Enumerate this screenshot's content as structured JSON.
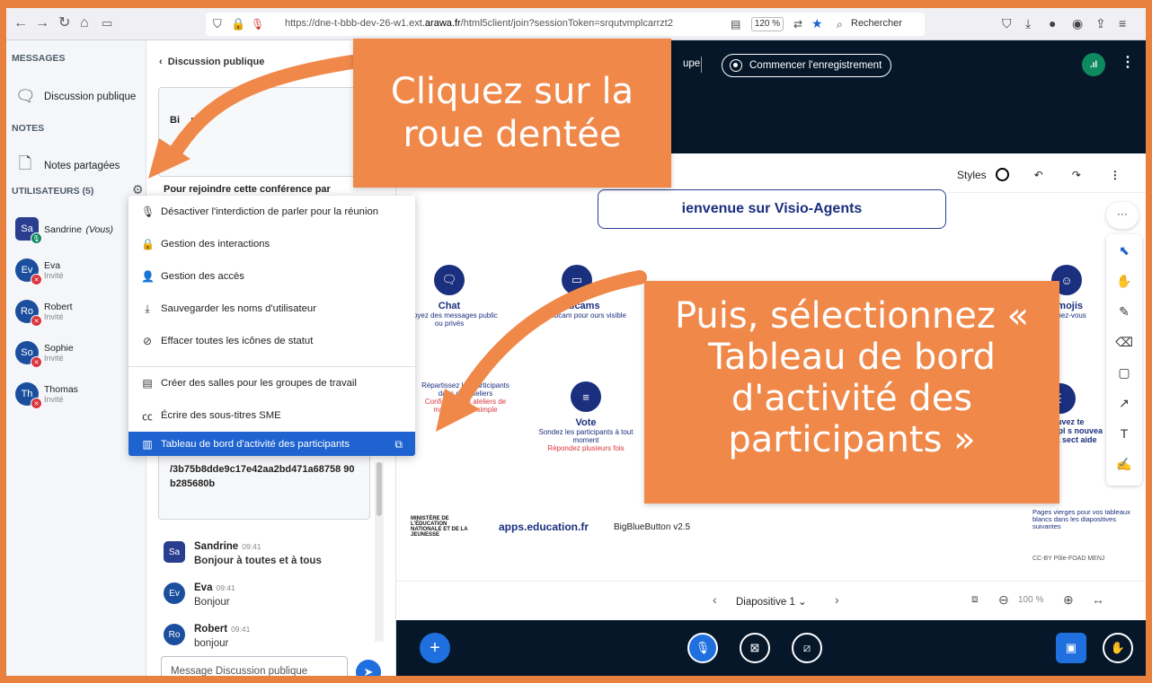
{
  "browser": {
    "url_prefix": "https://dne-t-bbb-dev-26-w1.ext.",
    "url_domain": "arawa.fr",
    "url_suffix": "/html5client/join?sessionToken=srqutvmplcarrzt2",
    "zoom": "120 %",
    "search_placeholder": "Rechercher"
  },
  "sidebar": {
    "messages_title": "MESSAGES",
    "public_chat": "Discussion publique",
    "notes_title": "NOTES",
    "shared_notes": "Notes partagées",
    "users_title": "UTILISATEURS (5)",
    "users": [
      {
        "initials": "Sa",
        "name": "Sandrine",
        "tag": "(Vous)",
        "role": ""
      },
      {
        "initials": "Ev",
        "name": "Eva",
        "tag": "",
        "role": "Invité"
      },
      {
        "initials": "Ro",
        "name": "Robert",
        "tag": "",
        "role": "Invité"
      },
      {
        "initials": "So",
        "name": "Sophie",
        "tag": "",
        "role": "Invité"
      },
      {
        "initials": "Th",
        "name": "Thomas",
        "tag": "",
        "role": "Invité"
      }
    ]
  },
  "chat": {
    "back_label": "Discussion publique",
    "welcome_partial": "Bi    nv",
    "join_text": "Pour rejoindre cette conférence par",
    "session_id": "/3b75b8dde9c17e42aa2bd471a68758 90b285680b",
    "messages": [
      {
        "initials": "Sa",
        "name": "Sandrine",
        "time": "09:41",
        "text": "Bonjour à toutes et à tous"
      },
      {
        "initials": "Ev",
        "name": "Eva",
        "time": "09:41",
        "text": "Bonjour"
      },
      {
        "initials": "Ro",
        "name": "Robert",
        "time": "09:41",
        "text": "bonjour"
      }
    ],
    "input_placeholder": "Message Discussion publique"
  },
  "menu": {
    "items": [
      "Désactiver l'interdiction de parler pour la réunion",
      "Gestion des interactions",
      "Gestion des accès",
      "Sauvegarder les noms d'utilisateur",
      "Effacer toutes les icônes de statut",
      "Créer des salles pour les groupes de travail",
      "Écrire des sous-titres SME",
      "Tableau de bord d'activité des participants"
    ]
  },
  "main": {
    "prev_label": "upe",
    "record_label": "Commencer l'enregistrement",
    "styles_label": "Styles",
    "slide_title": "ienvenue sur Visio-Agents",
    "features": [
      {
        "name": "Chat",
        "desc": "Envoyez des messages public ou privés",
        "note": ""
      },
      {
        "name": "Webcams",
        "desc": "ebcam pour ours visible",
        "note": ""
      },
      {
        "name": "Emojis",
        "desc": "primez-vous",
        "note": ""
      },
      {
        "name": "",
        "desc": "Répartissez les participants dans des ateliers",
        "note": "Configurez les ateliers de manière plus simple"
      },
      {
        "name": "Vote",
        "desc": "Sondez les participants à tout moment",
        "note": "Répondez plusieurs fois"
      },
      {
        "name": "",
        "desc": "etrouvez te compl s nouvea ns la sect aide",
        "note": ""
      }
    ],
    "ministere": "MINISTÈRE DE L'ÉDUCATION NATIONALE ET DE LA JEUNESSE",
    "apps_logo": "apps.education.fr",
    "bbb_logo": "BigBlueButton",
    "bbb_version": "v2.5",
    "pages_note": "Pages vierges pour vos tableaux blancs dans les diapositives suivantes",
    "cc_note": "CC-BY Pôle-FOAD MENJ",
    "slide_label": "Diapositive 1",
    "zoom_label": "100 %"
  },
  "callouts": {
    "first": "Cliquez sur la roue dentée",
    "second": "Puis, sélectionnez « Tableau de bord d'activité des participants »"
  },
  "colors": {
    "accent": "#1e63cf",
    "callout": "#f0884a",
    "dark": "#06172a"
  }
}
